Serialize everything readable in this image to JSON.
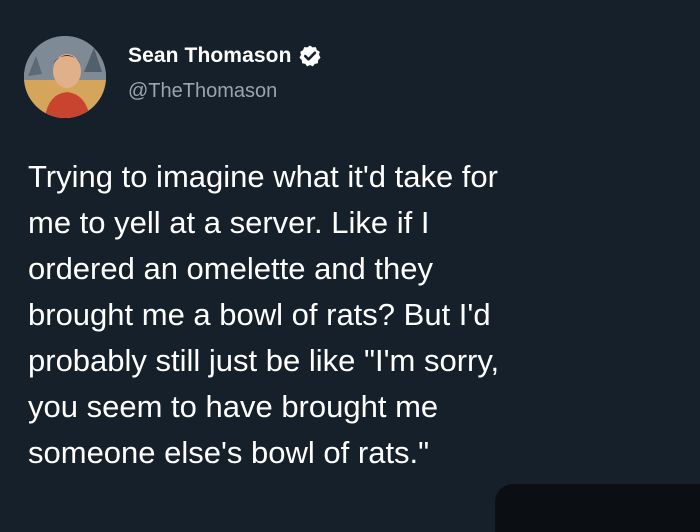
{
  "tweet": {
    "author": {
      "name": "Sean Thomason",
      "handle": "@TheThomason",
      "verified": true
    },
    "text": "Trying to imagine what it'd take for\nme to yell at a server. Like if I\nordered an omelette and they\nbrought me a bowl of rats? But I'd\nprobably still just be like \"I'm sorry,\nyou seem to have brought me\nsomeone else's bowl of rats.\""
  },
  "colors": {
    "background": "#16202b",
    "text": "#ffffff",
    "handle": "#9aa4b0",
    "verified_badge": "#ffffff"
  },
  "icons": {
    "verified": "verified-badge-icon",
    "avatar": "profile-photo"
  }
}
